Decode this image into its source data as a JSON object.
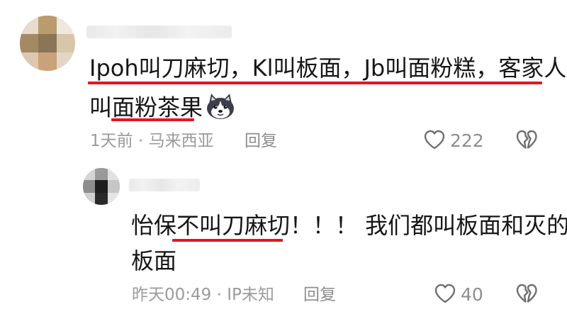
{
  "comments": [
    {
      "line1": "Ipoh叫刀麻切，Kl叫板面，Jb叫面粉糕，客家人",
      "line2": "叫面粉茶果",
      "emoji": "husky-dog-emoji",
      "meta": "1天前 · 马来西亚",
      "reply_label": "回复",
      "likes": "222"
    },
    {
      "line1": "怡保不叫刀麻切！！！ 我们都叫板面和灭的",
      "line2": "板面",
      "meta": "昨天00:49 · IP未知",
      "reply_label": "回复",
      "likes": "40"
    }
  ],
  "colors": {
    "underline": "#e8141e",
    "text": "#161616",
    "meta": "#9b9b9b"
  },
  "icons": [
    "heart-outline-icon",
    "broken-heart-icon"
  ]
}
